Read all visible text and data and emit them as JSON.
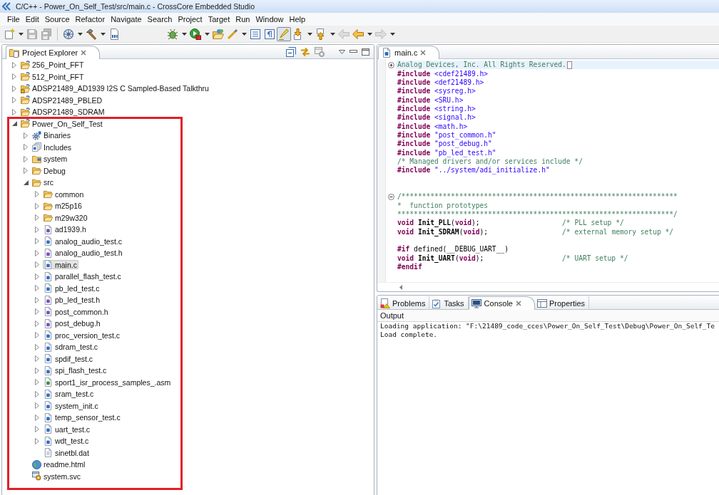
{
  "window": {
    "title": "C/C++ - Power_On_Self_Test/src/main.c - CrossCore Embedded Studio"
  },
  "menu": [
    "File",
    "Edit",
    "Source",
    "Refactor",
    "Navigate",
    "Search",
    "Project",
    "Target",
    "Run",
    "Window",
    "Help"
  ],
  "toolbar": [
    {
      "kind": "new",
      "disabled": false,
      "pressed": false,
      "dropdown": true
    },
    {
      "kind": "save",
      "disabled": true,
      "pressed": false,
      "dropdown": false
    },
    {
      "kind": "saveall",
      "disabled": true,
      "pressed": false,
      "dropdown": false
    },
    {
      "kind": "separator"
    },
    {
      "kind": "target",
      "disabled": false,
      "pressed": false,
      "dropdown": true
    },
    {
      "kind": "build",
      "disabled": false,
      "pressed": false,
      "dropdown": true
    },
    {
      "kind": "binary",
      "disabled": false,
      "pressed": false,
      "dropdown": false
    },
    {
      "kind": "spacer"
    },
    {
      "kind": "debug",
      "disabled": false,
      "pressed": false,
      "dropdown": true
    },
    {
      "kind": "run",
      "disabled": false,
      "pressed": false,
      "dropdown": true
    },
    {
      "kind": "open",
      "disabled": false,
      "pressed": false,
      "dropdown": false
    },
    {
      "kind": "wand",
      "disabled": false,
      "pressed": false,
      "dropdown": true
    },
    {
      "kind": "list",
      "disabled": false,
      "pressed": false,
      "dropdown": false
    },
    {
      "kind": "pilcrow",
      "disabled": false,
      "pressed": false,
      "dropdown": false
    },
    {
      "kind": "highlight",
      "disabled": false,
      "pressed": true,
      "dropdown": false
    },
    {
      "kind": "down",
      "disabled": false,
      "pressed": false,
      "dropdown": true
    },
    {
      "kind": "up",
      "disabled": false,
      "pressed": false,
      "dropdown": true
    },
    {
      "kind": "back",
      "disabled": true,
      "pressed": false,
      "dropdown": false
    },
    {
      "kind": "previous",
      "disabled": false,
      "pressed": false,
      "dropdown": true
    },
    {
      "kind": "forward",
      "disabled": true,
      "pressed": false,
      "dropdown": true
    }
  ],
  "explorer": {
    "title": "Project Explorer",
    "projects": [
      {
        "label": "256_Point_FFT",
        "kind": "project",
        "expanded": false,
        "selected": false,
        "flagged": false,
        "highlighted": false
      },
      {
        "label": "512_Point_FFT",
        "kind": "project",
        "expanded": false,
        "selected": false,
        "flagged": false,
        "highlighted": false
      },
      {
        "label": "ADSP21489_AD1939 I2S C Sampled-Based Talkthru",
        "kind": "project",
        "expanded": false,
        "selected": false,
        "flagged": true,
        "highlighted": false
      },
      {
        "label": "ADSP21489_PBLED",
        "kind": "project",
        "expanded": false,
        "selected": false,
        "flagged": false,
        "highlighted": false
      },
      {
        "label": "ADSP21489_SDRAM",
        "kind": "project",
        "expanded": false,
        "selected": false,
        "flagged": false,
        "highlighted": false
      },
      {
        "label": "Power_On_Self_Test",
        "kind": "project",
        "expanded": true,
        "selected": false,
        "flagged": false,
        "highlighted": true,
        "children": [
          {
            "label": "Binaries",
            "kind": "binaries",
            "expanded": false,
            "selected": false
          },
          {
            "label": "Includes",
            "kind": "includes",
            "expanded": false,
            "selected": false
          },
          {
            "label": "system",
            "kind": "package",
            "expanded": false,
            "selected": false
          },
          {
            "label": "Debug",
            "kind": "folder",
            "expanded": false,
            "selected": false
          },
          {
            "label": "src",
            "kind": "folder",
            "expanded": true,
            "selected": false,
            "children": [
              {
                "label": "common",
                "kind": "folder",
                "expanded": false,
                "selected": false
              },
              {
                "label": "m25p16",
                "kind": "folder",
                "expanded": false,
                "selected": false
              },
              {
                "label": "m29w320",
                "kind": "folder",
                "expanded": false,
                "selected": false
              },
              {
                "label": "ad1939.h",
                "kind": "header",
                "expanded": false,
                "selected": false
              },
              {
                "label": "analog_audio_test.c",
                "kind": "source",
                "expanded": false,
                "selected": false
              },
              {
                "label": "analog_audio_test.h",
                "kind": "header",
                "expanded": false,
                "selected": false
              },
              {
                "label": "main.c",
                "kind": "source",
                "expanded": false,
                "selected": true
              },
              {
                "label": "parallel_flash_test.c",
                "kind": "source",
                "expanded": false,
                "selected": false
              },
              {
                "label": "pb_led_test.c",
                "kind": "source",
                "expanded": false,
                "selected": false
              },
              {
                "label": "pb_led_test.h",
                "kind": "header",
                "expanded": false,
                "selected": false
              },
              {
                "label": "post_common.h",
                "kind": "header",
                "expanded": false,
                "selected": false
              },
              {
                "label": "post_debug.h",
                "kind": "header",
                "expanded": false,
                "selected": false
              },
              {
                "label": "proc_version_test.c",
                "kind": "source",
                "expanded": false,
                "selected": false
              },
              {
                "label": "sdram_test.c",
                "kind": "source",
                "expanded": false,
                "selected": false
              },
              {
                "label": "spdif_test.c",
                "kind": "source",
                "expanded": false,
                "selected": false
              },
              {
                "label": "spi_flash_test.c",
                "kind": "source",
                "expanded": false,
                "selected": false
              },
              {
                "label": "sport1_isr_process_samples_.asm",
                "kind": "assembly",
                "expanded": false,
                "selected": false
              },
              {
                "label": "sram_test.c",
                "kind": "source",
                "expanded": false,
                "selected": false
              },
              {
                "label": "system_init.c",
                "kind": "source",
                "expanded": false,
                "selected": false
              },
              {
                "label": "temp_sensor_test.c",
                "kind": "source",
                "expanded": false,
                "selected": false
              },
              {
                "label": "uart_test.c",
                "kind": "source",
                "expanded": false,
                "selected": false
              },
              {
                "label": "wdt_test.c",
                "kind": "source",
                "expanded": false,
                "selected": false
              },
              {
                "label": "sinetbl.dat",
                "kind": "data",
                "selected": false
              }
            ]
          },
          {
            "label": "readme.html",
            "kind": "web",
            "selected": false
          },
          {
            "label": "system.svc",
            "kind": "service",
            "selected": false
          }
        ]
      }
    ]
  },
  "editor": {
    "tabs": [
      {
        "label": "main.c",
        "kind": "source",
        "selected": true
      }
    ],
    "lines": [
      {
        "current": true,
        "collapsed": true,
        "tokens": [
          {
            "kind": "comment",
            "text": "Analog Devices, Inc. All Rights Reserved."
          }
        ]
      },
      {
        "current": false,
        "tokens": [
          {
            "kind": "directive",
            "text": "#include "
          },
          {
            "kind": "header",
            "text": "<cdef21489.h>"
          }
        ]
      },
      {
        "current": false,
        "tokens": [
          {
            "kind": "directive",
            "text": "#include "
          },
          {
            "kind": "header",
            "text": "<def21489.h>"
          }
        ]
      },
      {
        "current": false,
        "tokens": [
          {
            "kind": "directive",
            "text": "#include "
          },
          {
            "kind": "header",
            "text": "<sysreg.h>"
          }
        ]
      },
      {
        "current": false,
        "tokens": [
          {
            "kind": "directive",
            "text": "#include "
          },
          {
            "kind": "header",
            "text": "<SRU.h>"
          }
        ]
      },
      {
        "current": false,
        "tokens": [
          {
            "kind": "directive",
            "text": "#include "
          },
          {
            "kind": "header",
            "text": "<string.h>"
          }
        ]
      },
      {
        "current": false,
        "tokens": [
          {
            "kind": "directive",
            "text": "#include "
          },
          {
            "kind": "header",
            "text": "<signal.h>"
          }
        ]
      },
      {
        "current": false,
        "tokens": [
          {
            "kind": "directive",
            "text": "#include "
          },
          {
            "kind": "header",
            "text": "<math.h>"
          }
        ]
      },
      {
        "current": false,
        "tokens": [
          {
            "kind": "directive",
            "text": "#include "
          },
          {
            "kind": "string",
            "text": "\"post_common.h\""
          }
        ]
      },
      {
        "current": false,
        "tokens": [
          {
            "kind": "directive",
            "text": "#include "
          },
          {
            "kind": "string",
            "text": "\"post_debug.h\""
          }
        ]
      },
      {
        "current": false,
        "tokens": [
          {
            "kind": "directive",
            "text": "#include "
          },
          {
            "kind": "string",
            "text": "\"pb_led_test.h\""
          }
        ]
      },
      {
        "current": false,
        "tokens": [
          {
            "kind": "comment",
            "text": "/* Managed drivers and/or services include */"
          }
        ]
      },
      {
        "current": false,
        "tokens": [
          {
            "kind": "directive",
            "text": "#include "
          },
          {
            "kind": "string",
            "text": "\"../system/adi_initialize.h\""
          }
        ]
      },
      {
        "current": false
      },
      {
        "current": false
      },
      {
        "current": false,
        "collapsed": false,
        "tokens": [
          {
            "kind": "comment",
            "text": "/*******************************************************************"
          }
        ]
      },
      {
        "current": false,
        "tokens": [
          {
            "kind": "comment",
            "text": "*  function prototypes"
          }
        ]
      },
      {
        "current": false,
        "tokens": [
          {
            "kind": "comment",
            "text": "*******************************************************************/"
          }
        ]
      },
      {
        "current": false,
        "tokens": [
          {
            "kind": "keyword",
            "text": "void "
          },
          {
            "kind": "name",
            "text": "Init_PLL"
          },
          {
            "kind": "plain",
            "text": "("
          },
          {
            "kind": "keyword",
            "text": "void"
          },
          {
            "kind": "plain",
            "text": ");                    "
          },
          {
            "kind": "comment",
            "text": "/* PLL setup */"
          }
        ]
      },
      {
        "current": false,
        "tokens": [
          {
            "kind": "keyword",
            "text": "void "
          },
          {
            "kind": "name",
            "text": "Init_SDRAM"
          },
          {
            "kind": "plain",
            "text": "("
          },
          {
            "kind": "keyword",
            "text": "void"
          },
          {
            "kind": "plain",
            "text": ");                  "
          },
          {
            "kind": "comment",
            "text": "/* external memory setup */"
          }
        ]
      },
      {
        "current": false
      },
      {
        "current": false,
        "tokens": [
          {
            "kind": "directive",
            "text": "#if "
          },
          {
            "kind": "plain",
            "text": "defined(__DEBUG_UART__)"
          }
        ]
      },
      {
        "current": false,
        "tokens": [
          {
            "kind": "keyword",
            "text": "void "
          },
          {
            "kind": "name",
            "text": "Init_UART"
          },
          {
            "kind": "plain",
            "text": "("
          },
          {
            "kind": "keyword",
            "text": "void"
          },
          {
            "kind": "plain",
            "text": ");                   "
          },
          {
            "kind": "comment",
            "text": "/* UART setup */"
          }
        ]
      },
      {
        "current": false,
        "tokens": [
          {
            "kind": "directive",
            "text": "#endif"
          }
        ]
      }
    ]
  },
  "console_panel": {
    "tabs": [
      {
        "label": "Problems",
        "kind": "problems",
        "selected": false
      },
      {
        "label": "Tasks",
        "kind": "tasks",
        "selected": false
      },
      {
        "label": "Console",
        "kind": "console",
        "selected": true
      },
      {
        "label": "Properties",
        "kind": "properties",
        "selected": false
      }
    ],
    "output_label": "Output",
    "lines": [
      "Loading application: \"F:\\21489_code_cces\\Power_On_Self_Test\\Debug\\Power_On_Self_Te",
      "Load complete."
    ]
  }
}
